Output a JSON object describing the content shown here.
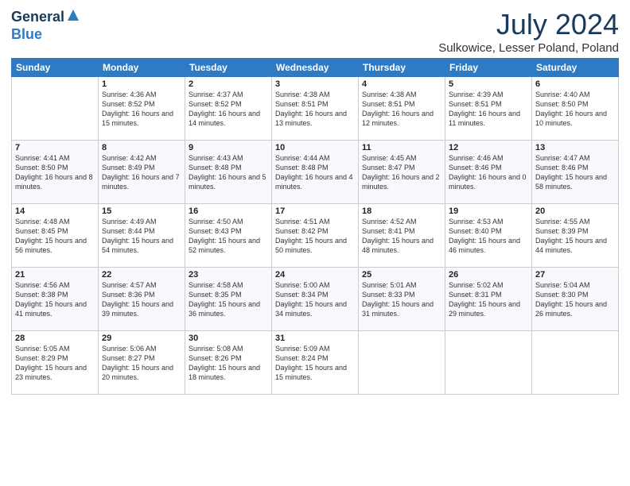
{
  "header": {
    "logo_general": "General",
    "logo_blue": "Blue",
    "month_year": "July 2024",
    "location": "Sulkowice, Lesser Poland, Poland"
  },
  "days_of_week": [
    "Sunday",
    "Monday",
    "Tuesday",
    "Wednesday",
    "Thursday",
    "Friday",
    "Saturday"
  ],
  "weeks": [
    [
      {
        "day": "",
        "info": ""
      },
      {
        "day": "1",
        "info": "Sunrise: 4:36 AM\nSunset: 8:52 PM\nDaylight: 16 hours and 15 minutes."
      },
      {
        "day": "2",
        "info": "Sunrise: 4:37 AM\nSunset: 8:52 PM\nDaylight: 16 hours and 14 minutes."
      },
      {
        "day": "3",
        "info": "Sunrise: 4:38 AM\nSunset: 8:51 PM\nDaylight: 16 hours and 13 minutes."
      },
      {
        "day": "4",
        "info": "Sunrise: 4:38 AM\nSunset: 8:51 PM\nDaylight: 16 hours and 12 minutes."
      },
      {
        "day": "5",
        "info": "Sunrise: 4:39 AM\nSunset: 8:51 PM\nDaylight: 16 hours and 11 minutes."
      },
      {
        "day": "6",
        "info": "Sunrise: 4:40 AM\nSunset: 8:50 PM\nDaylight: 16 hours and 10 minutes."
      }
    ],
    [
      {
        "day": "7",
        "info": "Sunrise: 4:41 AM\nSunset: 8:50 PM\nDaylight: 16 hours and 8 minutes."
      },
      {
        "day": "8",
        "info": "Sunrise: 4:42 AM\nSunset: 8:49 PM\nDaylight: 16 hours and 7 minutes."
      },
      {
        "day": "9",
        "info": "Sunrise: 4:43 AM\nSunset: 8:48 PM\nDaylight: 16 hours and 5 minutes."
      },
      {
        "day": "10",
        "info": "Sunrise: 4:44 AM\nSunset: 8:48 PM\nDaylight: 16 hours and 4 minutes."
      },
      {
        "day": "11",
        "info": "Sunrise: 4:45 AM\nSunset: 8:47 PM\nDaylight: 16 hours and 2 minutes."
      },
      {
        "day": "12",
        "info": "Sunrise: 4:46 AM\nSunset: 8:46 PM\nDaylight: 16 hours and 0 minutes."
      },
      {
        "day": "13",
        "info": "Sunrise: 4:47 AM\nSunset: 8:46 PM\nDaylight: 15 hours and 58 minutes."
      }
    ],
    [
      {
        "day": "14",
        "info": "Sunrise: 4:48 AM\nSunset: 8:45 PM\nDaylight: 15 hours and 56 minutes."
      },
      {
        "day": "15",
        "info": "Sunrise: 4:49 AM\nSunset: 8:44 PM\nDaylight: 15 hours and 54 minutes."
      },
      {
        "day": "16",
        "info": "Sunrise: 4:50 AM\nSunset: 8:43 PM\nDaylight: 15 hours and 52 minutes."
      },
      {
        "day": "17",
        "info": "Sunrise: 4:51 AM\nSunset: 8:42 PM\nDaylight: 15 hours and 50 minutes."
      },
      {
        "day": "18",
        "info": "Sunrise: 4:52 AM\nSunset: 8:41 PM\nDaylight: 15 hours and 48 minutes."
      },
      {
        "day": "19",
        "info": "Sunrise: 4:53 AM\nSunset: 8:40 PM\nDaylight: 15 hours and 46 minutes."
      },
      {
        "day": "20",
        "info": "Sunrise: 4:55 AM\nSunset: 8:39 PM\nDaylight: 15 hours and 44 minutes."
      }
    ],
    [
      {
        "day": "21",
        "info": "Sunrise: 4:56 AM\nSunset: 8:38 PM\nDaylight: 15 hours and 41 minutes."
      },
      {
        "day": "22",
        "info": "Sunrise: 4:57 AM\nSunset: 8:36 PM\nDaylight: 15 hours and 39 minutes."
      },
      {
        "day": "23",
        "info": "Sunrise: 4:58 AM\nSunset: 8:35 PM\nDaylight: 15 hours and 36 minutes."
      },
      {
        "day": "24",
        "info": "Sunrise: 5:00 AM\nSunset: 8:34 PM\nDaylight: 15 hours and 34 minutes."
      },
      {
        "day": "25",
        "info": "Sunrise: 5:01 AM\nSunset: 8:33 PM\nDaylight: 15 hours and 31 minutes."
      },
      {
        "day": "26",
        "info": "Sunrise: 5:02 AM\nSunset: 8:31 PM\nDaylight: 15 hours and 29 minutes."
      },
      {
        "day": "27",
        "info": "Sunrise: 5:04 AM\nSunset: 8:30 PM\nDaylight: 15 hours and 26 minutes."
      }
    ],
    [
      {
        "day": "28",
        "info": "Sunrise: 5:05 AM\nSunset: 8:29 PM\nDaylight: 15 hours and 23 minutes."
      },
      {
        "day": "29",
        "info": "Sunrise: 5:06 AM\nSunset: 8:27 PM\nDaylight: 15 hours and 20 minutes."
      },
      {
        "day": "30",
        "info": "Sunrise: 5:08 AM\nSunset: 8:26 PM\nDaylight: 15 hours and 18 minutes."
      },
      {
        "day": "31",
        "info": "Sunrise: 5:09 AM\nSunset: 8:24 PM\nDaylight: 15 hours and 15 minutes."
      },
      {
        "day": "",
        "info": ""
      },
      {
        "day": "",
        "info": ""
      },
      {
        "day": "",
        "info": ""
      }
    ]
  ]
}
